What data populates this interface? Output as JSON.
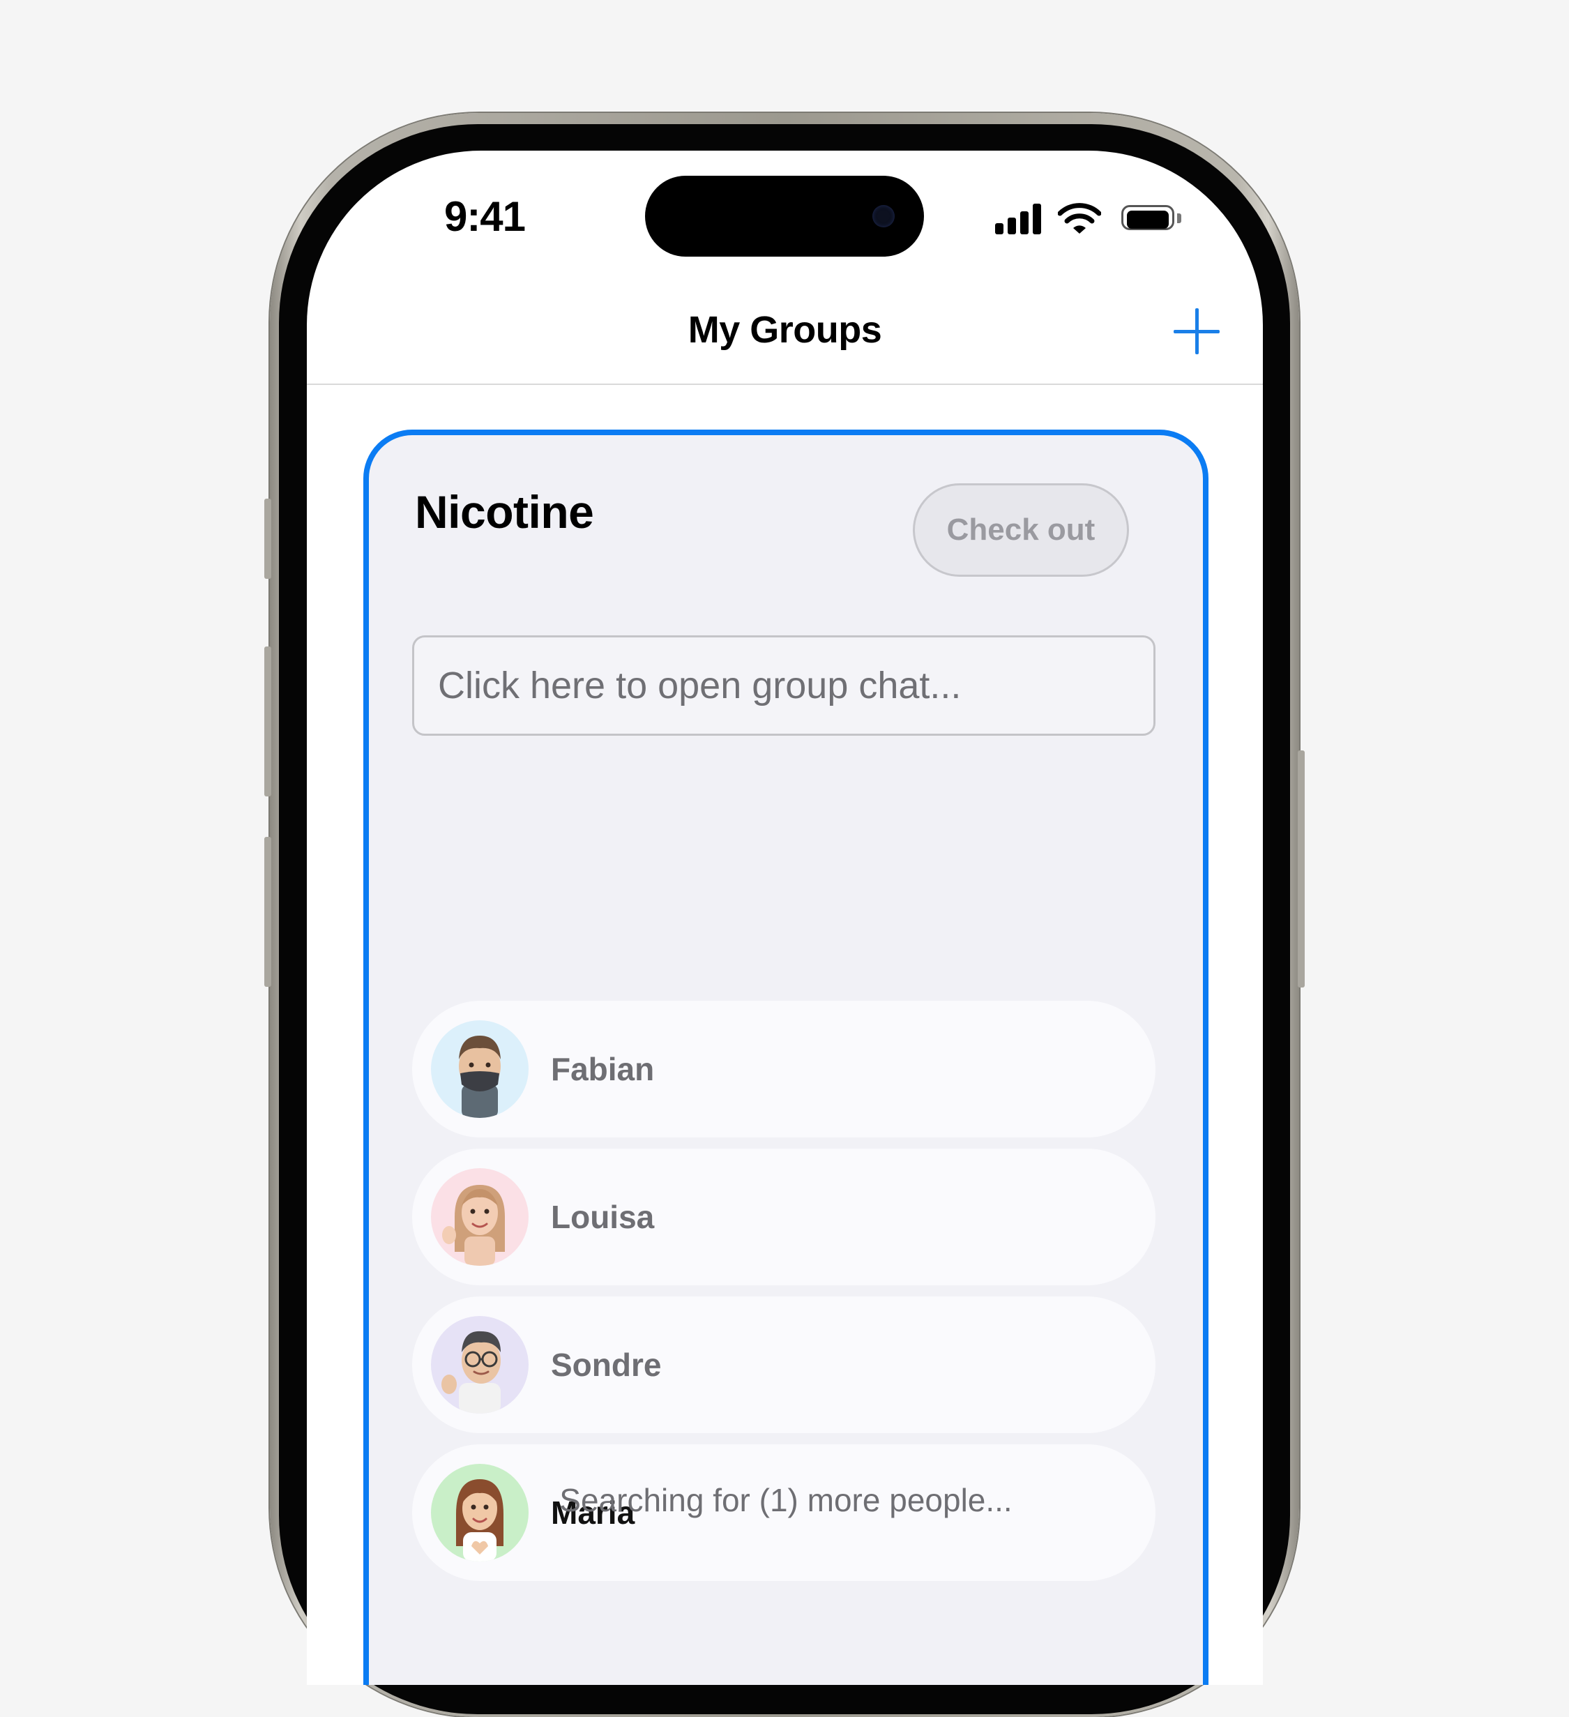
{
  "status_bar": {
    "time": "9:41"
  },
  "nav": {
    "title": "My Groups",
    "add_icon": "plus-icon"
  },
  "group": {
    "name": "Nicotine",
    "checkout_label": "Check out",
    "chat_placeholder": "Click here to open group chat...",
    "members": [
      {
        "name": "Fabian",
        "avatar_bg": "#dcf0fb",
        "active": false
      },
      {
        "name": "Louisa",
        "avatar_bg": "#fbe0e6",
        "active": false
      },
      {
        "name": "Sondre",
        "avatar_bg": "#e6e2f6",
        "active": false
      },
      {
        "name": "Maria",
        "avatar_bg": "#c9efc8",
        "active": true
      }
    ],
    "search_status": "Searching for (1) more people..."
  },
  "colors": {
    "accent": "#0b7cf3",
    "card_bg": "#f1f1f6",
    "muted_text": "#6e6e73"
  }
}
